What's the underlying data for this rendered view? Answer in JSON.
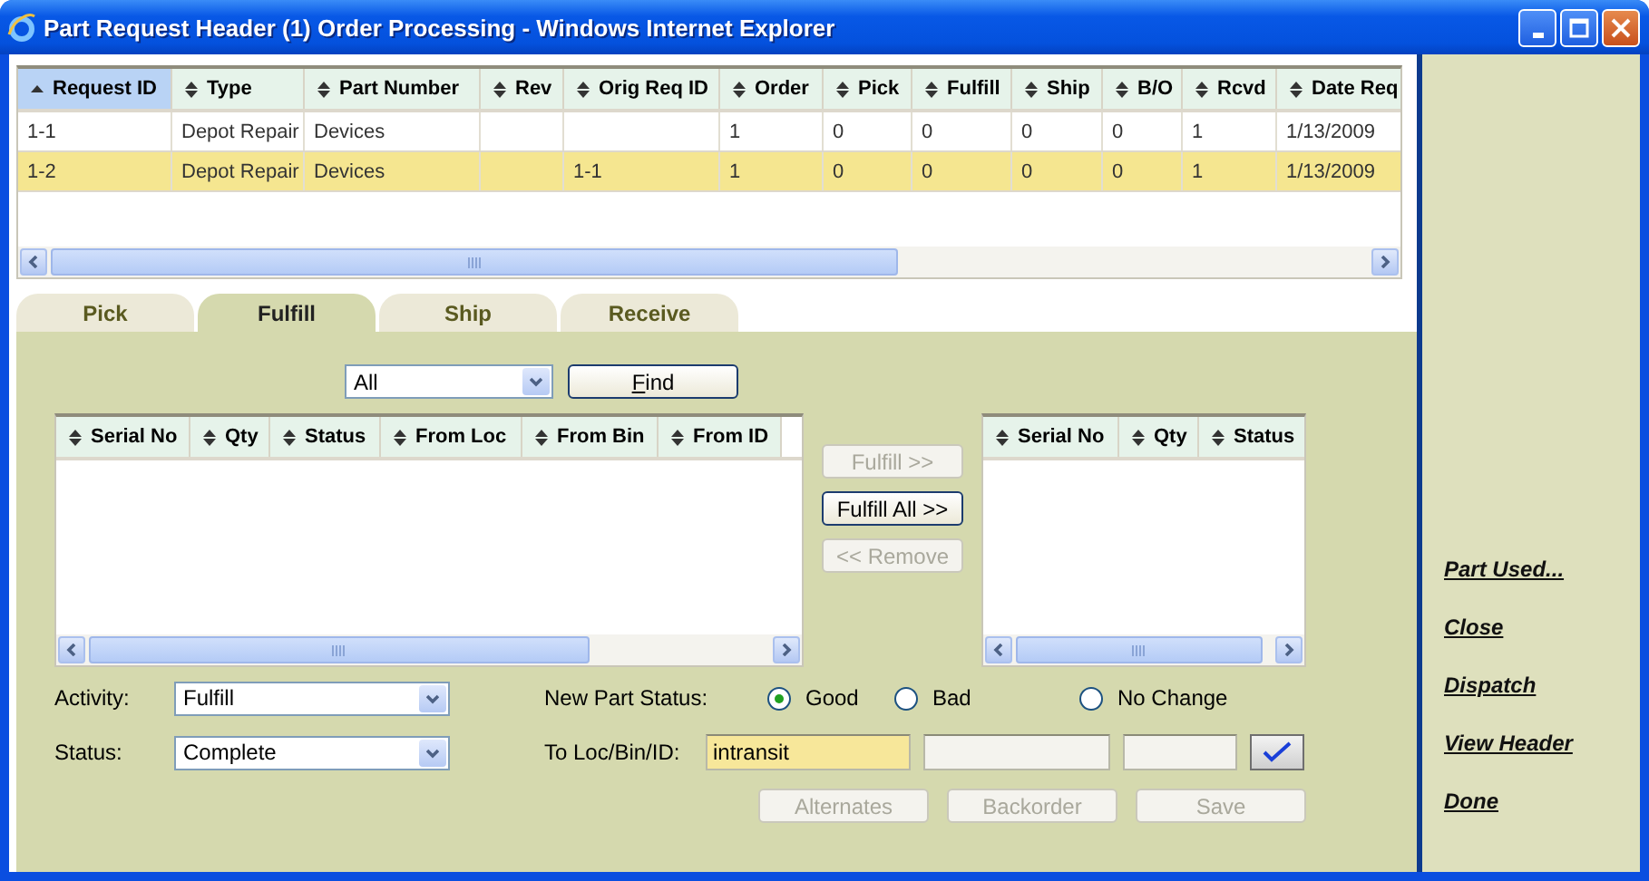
{
  "window": {
    "title": "Part Request Header (1) Order Processing - Windows Internet Explorer"
  },
  "request_table": {
    "columns": [
      {
        "label": "Request ID",
        "sorted": true
      },
      {
        "label": "Type",
        "sorted": false
      },
      {
        "label": "Part Number",
        "sorted": false
      },
      {
        "label": "Rev",
        "sorted": false
      },
      {
        "label": "Orig Req ID",
        "sorted": false
      },
      {
        "label": "Order",
        "sorted": false
      },
      {
        "label": "Pick",
        "sorted": false
      },
      {
        "label": "Fulfill",
        "sorted": false
      },
      {
        "label": "Ship",
        "sorted": false
      },
      {
        "label": "B/O",
        "sorted": false
      },
      {
        "label": "Rcvd",
        "sorted": false
      },
      {
        "label": "Date Req",
        "sorted": false
      }
    ],
    "rows": [
      {
        "selected": false,
        "cells": [
          "1-1",
          "Depot Repair",
          "Devices",
          null,
          null,
          "1",
          "0",
          "0",
          "0",
          "0",
          "1",
          "1/13/2009"
        ]
      },
      {
        "selected": true,
        "cells": [
          "1-2",
          "Depot Repair",
          "Devices",
          null,
          "1-1",
          "1",
          "0",
          "0",
          "0",
          "0",
          "1",
          "1/13/2009"
        ]
      }
    ]
  },
  "tabs": [
    {
      "label": "Pick",
      "selected": false
    },
    {
      "label": "Fulfill",
      "selected": true
    },
    {
      "label": "Ship",
      "selected": false
    },
    {
      "label": "Receive",
      "selected": false
    }
  ],
  "filter": {
    "value": "All"
  },
  "find_button": "Find",
  "source_table": {
    "columns": [
      "Serial No",
      "Qty",
      "Status",
      "From Loc",
      "From Bin",
      "From ID"
    ]
  },
  "move_buttons": [
    {
      "label": "Fulfill >>",
      "disabled": true
    },
    {
      "label": "Fulfill All >>",
      "disabled": false
    },
    {
      "label": "<< Remove",
      "disabled": true
    }
  ],
  "target_table": {
    "columns": [
      "Serial No",
      "Qty",
      "Status"
    ]
  },
  "form": {
    "activity": {
      "label": "Activity:",
      "value": "Fulfill"
    },
    "status": {
      "label": "Status:",
      "value": "Complete"
    },
    "new_part_status": {
      "label": "New Part Status:",
      "options": [
        {
          "label": "Good",
          "selected": true
        },
        {
          "label": "Bad",
          "selected": false
        },
        {
          "label": "No Change",
          "selected": false
        }
      ]
    },
    "to_loc": {
      "label": "To Loc/Bin/ID:",
      "fields": [
        {
          "value": "intransit",
          "highlighted": true
        },
        {
          "highlighted": false
        },
        {
          "highlighted": false
        }
      ]
    }
  },
  "actions": [
    {
      "label": "Alternates",
      "disabled": true
    },
    {
      "label": "Backorder",
      "disabled": true
    },
    {
      "label": "Save",
      "disabled": true
    }
  ],
  "sidebar_links": [
    "Part Used...",
    "Close",
    "Dispatch",
    "View Header",
    "Done"
  ]
}
